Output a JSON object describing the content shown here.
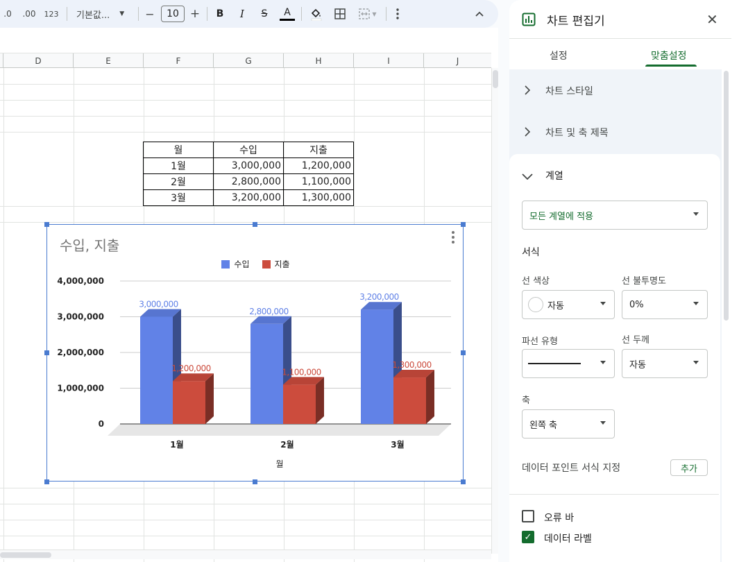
{
  "toolbar": {
    "decrease_decimal": ".0",
    "increase_decimal": ".00",
    "format_123": "123",
    "font_name": "기본값...",
    "minus": "−",
    "font_size": "10",
    "plus": "+",
    "bold": "B",
    "italic": "I",
    "strike": "S",
    "text_color": "A"
  },
  "columns": [
    "D",
    "E",
    "F",
    "G",
    "H",
    "I",
    "J"
  ],
  "table": {
    "headers": [
      "월",
      "수입",
      "지출"
    ],
    "rows": [
      [
        "1월",
        "3,000,000",
        "1,200,000"
      ],
      [
        "2월",
        "2,800,000",
        "1,100,000"
      ],
      [
        "3월",
        "3,200,000",
        "1,300,000"
      ]
    ]
  },
  "chart_data": {
    "type": "bar",
    "title": "수입, 지출",
    "xlabel": "월",
    "ylabel": "",
    "categories": [
      "1월",
      "2월",
      "3월"
    ],
    "series": [
      {
        "name": "수입",
        "values": [
          3000000,
          2800000,
          3200000
        ],
        "labels": [
          "3,000,000",
          "2,800,000",
          "3,200,000"
        ],
        "color": "#6182e7"
      },
      {
        "name": "지출",
        "values": [
          1200000,
          1100000,
          1300000
        ],
        "labels": [
          "1,200,000",
          "1,100,000",
          "1,300,000"
        ],
        "color": "#cc4c3d"
      }
    ],
    "ylim": [
      0,
      4000000
    ],
    "yticks": [
      "4,000,000",
      "3,000,000",
      "2,000,000",
      "1,000,000",
      "0"
    ],
    "legend": "top",
    "style": "3d"
  },
  "panel": {
    "title": "차트 편집기",
    "close": "✕",
    "tabs": [
      "설정",
      "맞춤설정"
    ],
    "active_tab": "맞춤설정",
    "sections": {
      "chart_style": "차트 스타일",
      "titles": "차트 및 축 제목",
      "series": "계열"
    },
    "series": {
      "apply_to": "모든 계열에 적용",
      "format_heading": "서식",
      "line_color_label": "선 색상",
      "line_color_value": "자동",
      "line_opacity_label": "선 불투명도",
      "line_opacity_value": "0%",
      "dash_type_label": "파선 유형",
      "line_width_label": "선 두께",
      "line_width_value": "자동",
      "axis_label": "축",
      "axis_value": "왼쪽 축",
      "data_point_format": "데이터 포인트 서식 지정",
      "add_button": "추가",
      "error_bars": "오류 바",
      "data_labels": "데이터 라벨"
    },
    "accent_color": "#146c2e"
  }
}
